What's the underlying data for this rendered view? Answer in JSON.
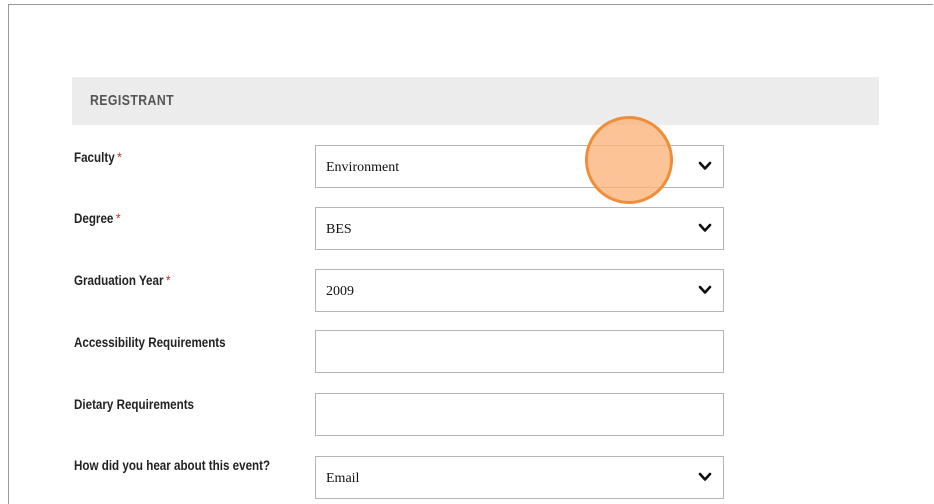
{
  "section": {
    "title": "REGISTRANT"
  },
  "fields": {
    "faculty": {
      "label": "Faculty",
      "required_mark": "*",
      "value": "Environment"
    },
    "degree": {
      "label": "Degree",
      "required_mark": "*",
      "value": "BES"
    },
    "graduation_year": {
      "label": "Graduation Year",
      "required_mark": "*",
      "value": "2009"
    },
    "accessibility": {
      "label": "Accessibility Requirements",
      "value": ""
    },
    "dietary": {
      "label": "Dietary Requirements",
      "value": ""
    },
    "hear_about": {
      "label": "How did you hear about this event?",
      "value": "Email"
    }
  },
  "icons": {
    "dropdown": "chevron-down-icon",
    "cursor": "click-indicator"
  },
  "colors": {
    "header_bg": "#ececec",
    "required": "#c0392b",
    "cursor_fill": "#fab278",
    "cursor_border": "#ef8e3a"
  }
}
